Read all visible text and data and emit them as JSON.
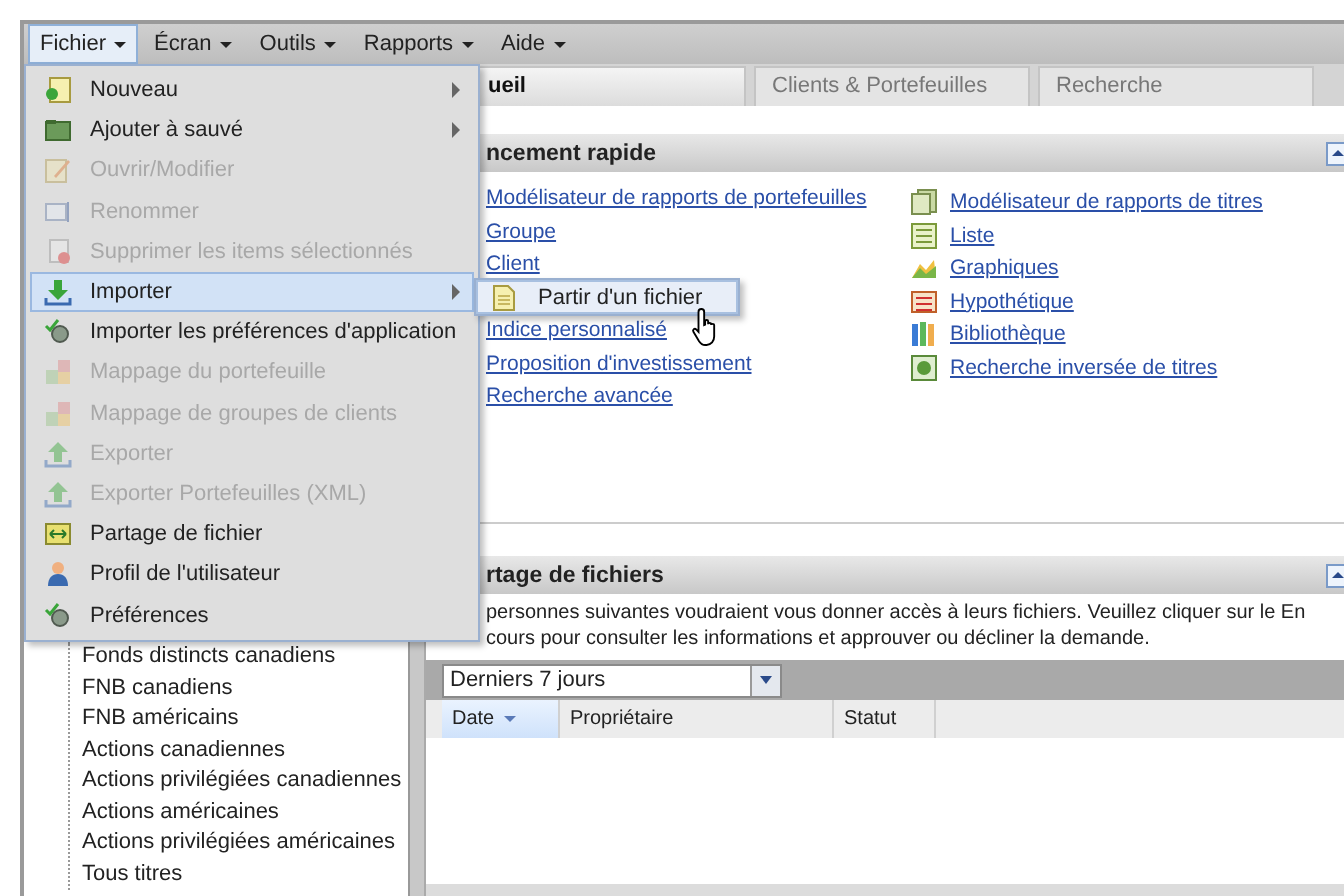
{
  "menubar": [
    {
      "label": "Fichier",
      "selected": true
    },
    {
      "label": "Écran",
      "selected": false
    },
    {
      "label": "Outils",
      "selected": false
    },
    {
      "label": "Rapports",
      "selected": false
    },
    {
      "label": "Aide",
      "selected": false
    }
  ],
  "file_menu": [
    {
      "label": "Nouveau",
      "submenu": true,
      "disabled": false,
      "selected": false
    },
    {
      "label": "Ajouter à sauvé",
      "submenu": true,
      "disabled": false,
      "selected": false
    },
    {
      "label": "Ouvrir/Modifier",
      "submenu": false,
      "disabled": true,
      "selected": false
    },
    {
      "label": "Renommer",
      "submenu": false,
      "disabled": true,
      "selected": false
    },
    {
      "label": "Supprimer les items sélectionnés",
      "submenu": false,
      "disabled": true,
      "selected": false
    },
    {
      "label": "Importer",
      "submenu": true,
      "disabled": false,
      "selected": true
    },
    {
      "label": "Importer les préférences d'application",
      "submenu": false,
      "disabled": false,
      "selected": false
    },
    {
      "label": "Mappage du portefeuille",
      "submenu": false,
      "disabled": true,
      "selected": false
    },
    {
      "label": "Mappage de groupes de clients",
      "submenu": false,
      "disabled": true,
      "selected": false
    },
    {
      "label": "Exporter",
      "submenu": false,
      "disabled": true,
      "selected": false
    },
    {
      "label": "Exporter Portefeuilles (XML)",
      "submenu": false,
      "disabled": true,
      "selected": false
    },
    {
      "label": "Partage de fichier",
      "submenu": false,
      "disabled": false,
      "selected": false
    },
    {
      "label": "Profil de l'utilisateur",
      "submenu": false,
      "disabled": false,
      "selected": false
    },
    {
      "label": "Préférences",
      "submenu": false,
      "disabled": false,
      "selected": false
    }
  ],
  "import_submenu": [
    {
      "label": "Partir d'un fichier",
      "selected": true
    }
  ],
  "tabs": [
    {
      "label": "ueil",
      "selected": true
    },
    {
      "label": "Clients & Portefeuilles",
      "selected": false
    },
    {
      "label": "Recherche",
      "selected": false
    }
  ],
  "quick_launch": {
    "title": "ncement rapide",
    "links_left": [
      "Modélisateur de rapports de portefeuilles",
      "Groupe",
      "Client",
      "Indice personnalisé",
      "Proposition d'investissement",
      "Recherche avancée"
    ],
    "links_right": [
      "Modélisateur de rapports de titres",
      "Liste",
      "Graphiques",
      "Hypothétique",
      "Bibliothèque",
      "Recherche inversée de titres"
    ]
  },
  "file_sharing": {
    "title": "rtage de fichiers",
    "message": "personnes suivantes voudraient vous donner accès à leurs fichiers. Veuillez cliquer sur le En cours pour consulter les informations et approuver ou décliner la demande.",
    "filter": "Derniers 7 jours",
    "columns": [
      {
        "label": "Date",
        "sorted": true
      },
      {
        "label": "Propriétaire",
        "sorted": false
      },
      {
        "label": "Statut",
        "sorted": false
      }
    ]
  },
  "sidebar": {
    "items": [
      "Fonds distincts canadiens",
      "FNB canadiens",
      "FNB américains",
      "Actions canadiennes",
      "Actions privilégiées canadiennes",
      "Actions américaines",
      "Actions privilégiées américaines",
      "Tous titres"
    ]
  }
}
